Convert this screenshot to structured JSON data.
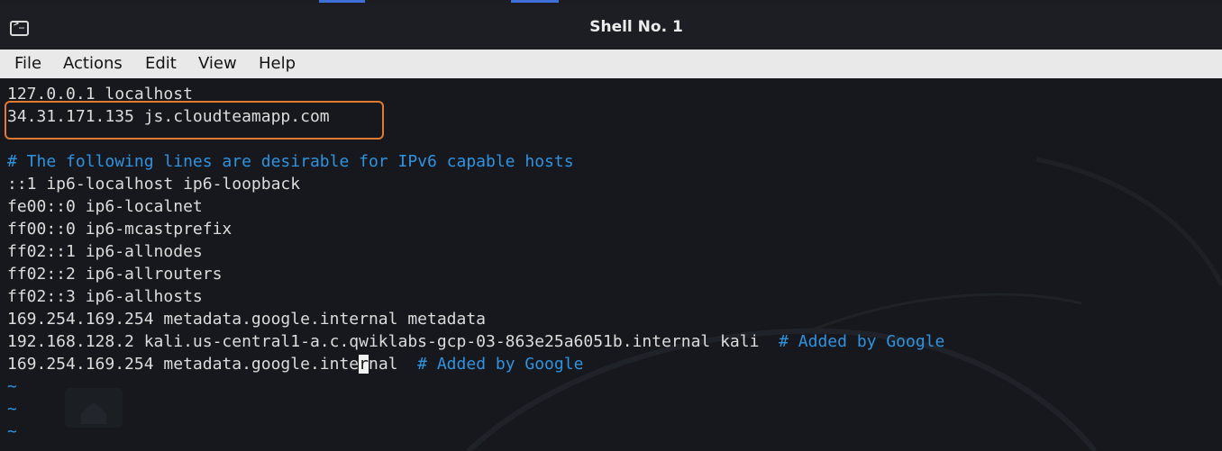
{
  "window": {
    "title": "Shell No. 1",
    "icon": "terminal-icon",
    "icon_prompt": ">_"
  },
  "menu": {
    "items": [
      "File",
      "Actions",
      "Edit",
      "View",
      "Help"
    ]
  },
  "terminal": {
    "lines": [
      {
        "text": "127.0.0.1 localhost"
      },
      {
        "text": "34.31.171.135 js.cloudteamapp.com",
        "highlighted": true
      },
      {
        "text": ""
      },
      {
        "comment": "# The following lines are desirable for IPv6 capable hosts"
      },
      {
        "text": "::1 ip6-localhost ip6-loopback"
      },
      {
        "text": "fe00::0 ip6-localnet"
      },
      {
        "text": "ff00::0 ip6-mcastprefix"
      },
      {
        "text": "ff02::1 ip6-allnodes"
      },
      {
        "text": "ff02::2 ip6-allrouters"
      },
      {
        "text": "ff02::3 ip6-allhosts"
      },
      {
        "text": "169.254.169.254 metadata.google.internal metadata"
      },
      {
        "text": "192.168.128.2 kali.us-central1-a.c.qwiklabs-gcp-03-863e25a6051b.internal kali  ",
        "comment": "# Added by Google"
      },
      {
        "text_before_cursor": "169.254.169.254 metadata.google.inte",
        "cursor_char": "r",
        "text_after_cursor": "nal  ",
        "comment": "# Added by Google"
      },
      {
        "tilde": "~"
      },
      {
        "tilde": "~"
      },
      {
        "tilde": "~"
      }
    ]
  },
  "colors": {
    "comment": "#2f93e0",
    "text": "#dcdcdc",
    "highlight_border": "#e07a2f",
    "menubar_bg": "#e9e9e9",
    "terminal_bg": "#16181d"
  }
}
